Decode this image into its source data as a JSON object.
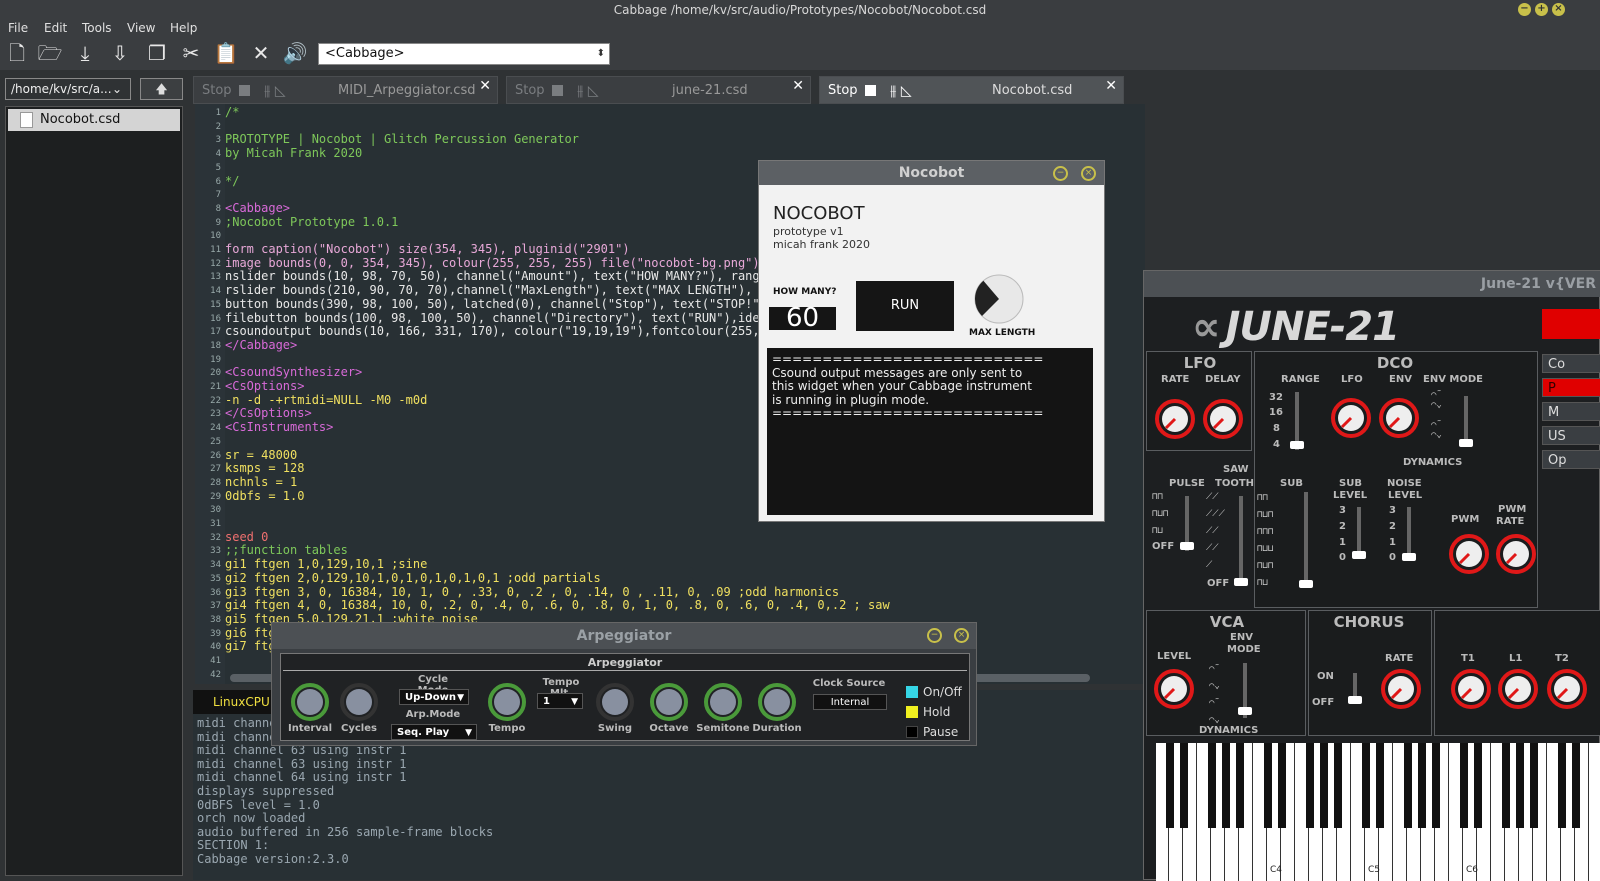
{
  "window": {
    "title": "Cabbage /home/kv/src/audio/Prototypes/Nocobot/Nocobot.csd"
  },
  "menu": [
    "File",
    "Edit",
    "Tools",
    "View",
    "Help"
  ],
  "toolbar": {
    "icons": [
      "new-file-icon",
      "open-file-icon",
      "save-icon",
      "save-as-icon",
      "copy-icon",
      "cut-icon",
      "paste-icon",
      "settings-icon",
      "audio-icon"
    ],
    "combo_value": "<Cabbage>"
  },
  "sidebar": {
    "dir": "/home/kv/src/a...",
    "file": "Nocobot.csd"
  },
  "tabs": [
    {
      "stop": "Stop",
      "name": "MIDI_Arpeggiator.csd",
      "close": "✕"
    },
    {
      "stop": "Stop",
      "name": "june-21.csd",
      "close": "✕"
    },
    {
      "stop": "Stop",
      "name": "Nocobot.csd",
      "close": "✕"
    }
  ],
  "editor": {
    "lines": [
      {
        "n": "1",
        "t": "/*",
        "c": "#7ec85a"
      },
      {
        "n": "2",
        "t": "",
        "c": "#7ec85a"
      },
      {
        "n": "3",
        "t": "PROTOTYPE | Nocobot | Glitch Percussion Generator",
        "c": "#7ec85a"
      },
      {
        "n": "4",
        "t": "by Micah Frank 2020",
        "c": "#7ec85a"
      },
      {
        "n": "5",
        "t": "",
        "c": "#7ec85a"
      },
      {
        "n": "6",
        "t": "*/",
        "c": "#7ec85a"
      },
      {
        "n": "7",
        "t": "",
        "c": "#ddd"
      },
      {
        "n": "8",
        "t": "<Cabbage>",
        "c": "#d86ad8"
      },
      {
        "n": "9",
        "t": ";Nocobot Prototype 1.0.1",
        "c": "#7ec85a"
      },
      {
        "n": "10",
        "t": "",
        "c": "#ddd"
      },
      {
        "n": "11",
        "t": "form caption(\"Nocobot\") size(354, 345), pluginid(\"2901\")",
        "c": "#e8a8d8"
      },
      {
        "n": "12",
        "t": "image bounds(0, 0, 354, 345), colour(255, 255, 255) file(\"nocobot-bg.png\")",
        "c": "#e8a8d8"
      },
      {
        "n": "13",
        "t": "nslider bounds(10, 98, 70, 50), channel(\"Amount\"), text(\"HOW MANY?\"), range",
        "c": "#e8e8e8"
      },
      {
        "n": "14",
        "t": "rslider bounds(210, 90, 70, 70),channel(\"MaxLength\"), text(\"MAX LENGTH\"), r",
        "c": "#e8e8e8"
      },
      {
        "n": "15",
        "t": "button bounds(390, 98, 100, 50), latched(0), channel(\"Stop\"), text(\"STOP!\")",
        "c": "#e8e8e8"
      },
      {
        "n": "16",
        "t": "filebutton bounds(100, 98, 100, 50), channel(\"Directory\"), text(\"RUN\"),iden",
        "c": "#e8e8e8"
      },
      {
        "n": "17",
        "t": "csoundoutput bounds(10, 166, 331, 170), colour(\"19,19,19\"),fontcolour(255,",
        "c": "#e8e8e8"
      },
      {
        "n": "18",
        "t": "</Cabbage>",
        "c": "#d86ad8"
      },
      {
        "n": "19",
        "t": "",
        "c": "#ddd"
      },
      {
        "n": "20",
        "t": "<CsoundSynthesizer>",
        "c": "#d86ad8"
      },
      {
        "n": "21",
        "t": "<CsOptions>",
        "c": "#d86ad8"
      },
      {
        "n": "22",
        "t": "-n -d -+rtmidi=NULL -M0 -m0d",
        "c": "#f0e060"
      },
      {
        "n": "23",
        "t": "</CsOptions>",
        "c": "#d86ad8"
      },
      {
        "n": "24",
        "t": "<CsInstruments>",
        "c": "#d86ad8"
      },
      {
        "n": "25",
        "t": "",
        "c": "#ddd"
      },
      {
        "n": "26",
        "t": "sr = 48000",
        "c": "#f0e060"
      },
      {
        "n": "27",
        "t": "ksmps = 128",
        "c": "#f0e060"
      },
      {
        "n": "28",
        "t": "nchnls = 1",
        "c": "#f0e060"
      },
      {
        "n": "29",
        "t": "0dbfs = 1.0",
        "c": "#f0e060"
      },
      {
        "n": "30",
        "t": "",
        "c": "#ddd"
      },
      {
        "n": "31",
        "t": "",
        "c": "#ddd"
      },
      {
        "n": "32",
        "t": "seed 0",
        "c": "#f07070"
      },
      {
        "n": "33",
        "t": ";;function tables",
        "c": "#7ec85a"
      },
      {
        "n": "34",
        "t": "gi1 ftgen 1,0,129,10,1 ;sine",
        "c": "#f0e060"
      },
      {
        "n": "35",
        "t": "gi2 ftgen 2,0,129,10,1,0,1,0,1,0,1,0,1 ;odd partials",
        "c": "#f0e060"
      },
      {
        "n": "36",
        "t": "gi3 ftgen 3, 0, 16384, 10, 1, 0 , .33, 0, .2 , 0, .14, 0 , .11, 0, .09 ;odd harmonics",
        "c": "#f0e060"
      },
      {
        "n": "37",
        "t": "gi4 ftgen 4, 0, 16384, 10, 0, .2, 0, .4, 0, .6, 0, .8, 0, 1, 0, .8, 0, .6, 0, .4, 0,.2 ; saw",
        "c": "#f0e060"
      },
      {
        "n": "38",
        "t": "gi5 ftgen 5,0,129,21,1 ;white noise",
        "c": "#f0e060"
      },
      {
        "n": "39",
        "t": "gi6 ftg",
        "c": "#f0e060"
      },
      {
        "n": "40",
        "t": "gi7 ftg",
        "c": "#f0e060"
      },
      {
        "n": "41",
        "t": "",
        "c": "#ddd"
      },
      {
        "n": "42",
        "t": "",
        "c": "#ddd"
      }
    ]
  },
  "console": {
    "tab": "LinuxCPU",
    "lines": [
      "midi channel",
      "midi channel",
      "midi channel 63 using instr 1",
      "midi channel 63 using instr 1",
      "midi channel 64 using instr 1",
      "displays suppressed",
      "0dBFS level = 1.0",
      "orch now loaded",
      "audio buffered in 256 sample-frame blocks",
      "SECTION 1:",
      "Cabbage version:2.3.0"
    ]
  },
  "nocobot": {
    "title": "Nocobot",
    "heading": "NOCOBOT",
    "sub1": "prototype v1",
    "sub2": "micah frank 2020",
    "howmany_label": "HOW MANY?",
    "howmany_value": "60",
    "run": "RUN",
    "maxlen_label": "MAX LENGTH",
    "maxlen_value": 0.35,
    "output": "===========================\nCsound output messages are only sent to\nthis widget when your Cabbage instrument\nis running in plugin mode.\n==========================="
  },
  "arp": {
    "title": "Arpeggiator",
    "panel_title": "Arpeggiator",
    "knobs": [
      "Interval",
      "Cycles",
      "Tempo",
      "Swing",
      "Octave",
      "Semitone",
      "Duration"
    ],
    "cycle_mode_label": "Cycle Mode",
    "cycle_mode": "Up-Down",
    "arp_mode_label": "Arp.Mode",
    "arp_mode": "Seq. Play",
    "tempo_mlt_label": "Tempo Mlt.",
    "tempo_mlt": "1",
    "clock_source_label": "Clock Source",
    "clock_source": "Internal",
    "checks": [
      {
        "label": "On/Off",
        "color": "#36d6e6"
      },
      {
        "label": "Hold",
        "color": "#f0f020"
      },
      {
        "label": "Pause",
        "color": "#000000"
      }
    ]
  },
  "june": {
    "title": "June-21 v{VER",
    "logo": "JUNE-21",
    "lfo": {
      "title": "LFO",
      "rate": "RATE",
      "delay": "DELAY"
    },
    "dco": {
      "title": "DCO",
      "range": "RANGE",
      "lfo": "LFO",
      "env": "ENV",
      "env_mode": "ENV MODE",
      "dynamics": "DYNAMICS",
      "ranges": [
        "32",
        "16",
        "8",
        "4"
      ]
    },
    "mix": {
      "pulse": "PULSE",
      "saw": "SAW",
      "tooth": "TOOTH",
      "sub": "SUB",
      "sub_level": "SUB",
      "sub_level2": "LEVEL",
      "noise": "NOISE",
      "noise2": "LEVEL",
      "pwm": "PWM",
      "pwm_rate": "PWM",
      "pwm_rate2": "RATE",
      "off": "OFF",
      "levels": [
        "3",
        "2",
        "1",
        "0"
      ]
    },
    "vca": {
      "title": "VCA",
      "level": "LEVEL",
      "env": "ENV",
      "mode": "MODE",
      "dynamics": "DYNAMICS"
    },
    "chorus": {
      "title": "CHORUS",
      "on": "ON",
      "off": "OFF",
      "rate": "RATE"
    },
    "right": {
      "t1": "T1",
      "l1": "L1",
      "t2": "T2"
    },
    "buttons": [
      "Co",
      "P",
      "M",
      "US",
      "Op"
    ],
    "keys": [
      "C4",
      "C5",
      "C6"
    ]
  }
}
